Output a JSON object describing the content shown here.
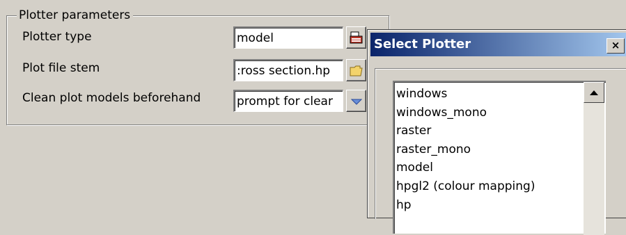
{
  "plotter_params": {
    "group_title": "Plotter parameters",
    "rows": [
      {
        "label": "Plotter type",
        "value": "model",
        "button_icon": "plotter-select-icon"
      },
      {
        "label": "Plot file stem",
        "value": ":ross section.hp",
        "button_icon": "folder-icon"
      },
      {
        "label": "Clean plot models beforehand",
        "value": "prompt for clear",
        "button_icon": "dropdown-arrow-icon"
      }
    ]
  },
  "dialog": {
    "title": "Select Plotter",
    "close_label": "×",
    "items": [
      "windows",
      "windows_mono",
      "raster",
      "raster_mono",
      "model",
      "hpgl2 (colour mapping)",
      "hp"
    ]
  },
  "colors": {
    "window_bg": "#d4d0c8",
    "title_gradient_start": "#0a246a",
    "title_gradient_end": "#a6caf0"
  }
}
